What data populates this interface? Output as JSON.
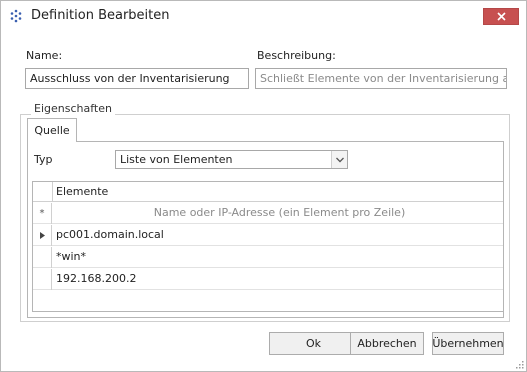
{
  "window": {
    "title": "Definition Bearbeiten"
  },
  "form": {
    "name_label": "Name:",
    "name_value": "Ausschluss von der Inventarisierung",
    "description_label": "Beschreibung:",
    "description_value": "Schließt Elemente von der Inventarisierung aus. Sie"
  },
  "properties": {
    "legend": "Eigenschaften",
    "tab_label": "Quelle",
    "type_label": "Typ",
    "type_selected": "Liste von Elementen"
  },
  "grid": {
    "column_header": "Elemente",
    "new_row_indicator": "*",
    "new_row_placeholder": "Name oder IP-Adresse (ein Element pro Zeile)",
    "rows": [
      {
        "value": "pc001.domain.local",
        "current": true
      },
      {
        "value": "*win*",
        "current": false
      },
      {
        "value": "192.168.200.2",
        "current": false
      }
    ]
  },
  "buttons": {
    "ok": "Ok",
    "cancel": "Abbrechen",
    "apply": "Übernehmen"
  },
  "colors": {
    "close_button": "#c75050",
    "app_icon": "#3a5fb0"
  },
  "icons": {
    "app": "grid-dots-icon",
    "close": "close-icon",
    "dropdown": "chevron-down-icon",
    "current_row": "triangle-right-icon",
    "resize": "resize-grip-icon"
  }
}
